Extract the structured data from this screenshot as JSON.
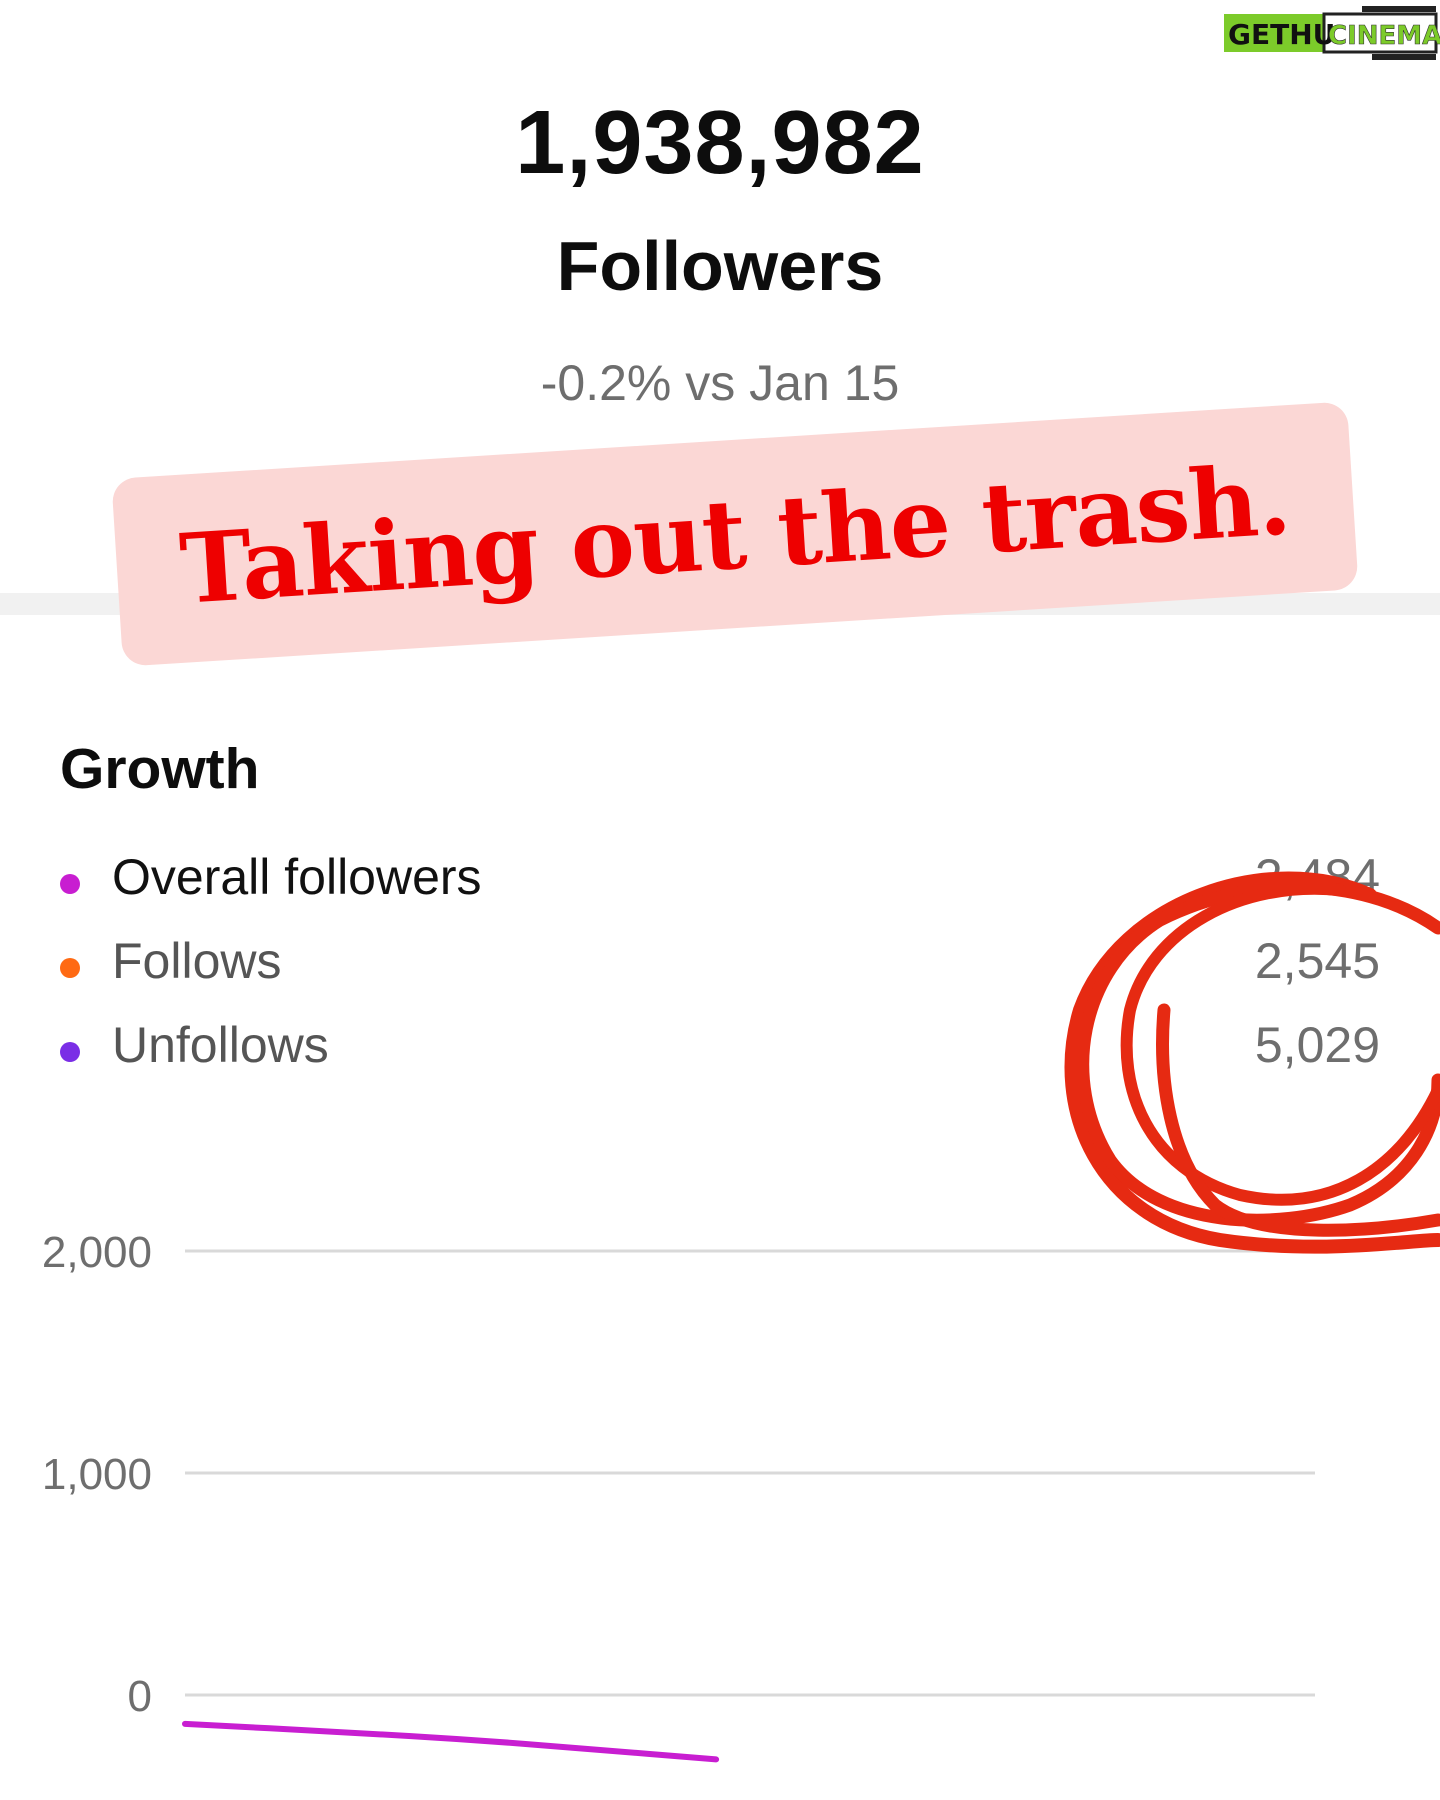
{
  "watermark": {
    "part1": "GETHU",
    "part2": "CINEMA"
  },
  "header": {
    "follower_count": "1,938,982",
    "follower_label": "Followers",
    "change_text": "-0.2% vs Jan 15"
  },
  "banner": {
    "text": "Taking out the trash."
  },
  "growth": {
    "title": "Growth",
    "legend": [
      {
        "label": "Overall followers",
        "value": "2,484",
        "color": "#c81ed1"
      },
      {
        "label": "Follows",
        "value": "2,545",
        "color": "#ff6a13"
      },
      {
        "label": "Unfollows",
        "value": "5,029",
        "color": "#7a2ee6"
      }
    ]
  },
  "chart_data": {
    "type": "line",
    "ylim": [
      0,
      2000
    ],
    "y_ticks": [
      "2,000",
      "1,000",
      "0"
    ],
    "grid": true,
    "series": [
      {
        "name": "Overall followers",
        "color": "#c81ed1",
        "x": [
          0,
          0.15,
          0.25,
          0.35,
          0.47
        ],
        "values": [
          -130,
          -170,
          -200,
          -240,
          -290
        ]
      }
    ]
  },
  "colors": {
    "banner_background": "#fbd7d5",
    "banner_text": "#ee0000",
    "annotation": "#e62a12",
    "gridline": "#d9d9d9"
  }
}
